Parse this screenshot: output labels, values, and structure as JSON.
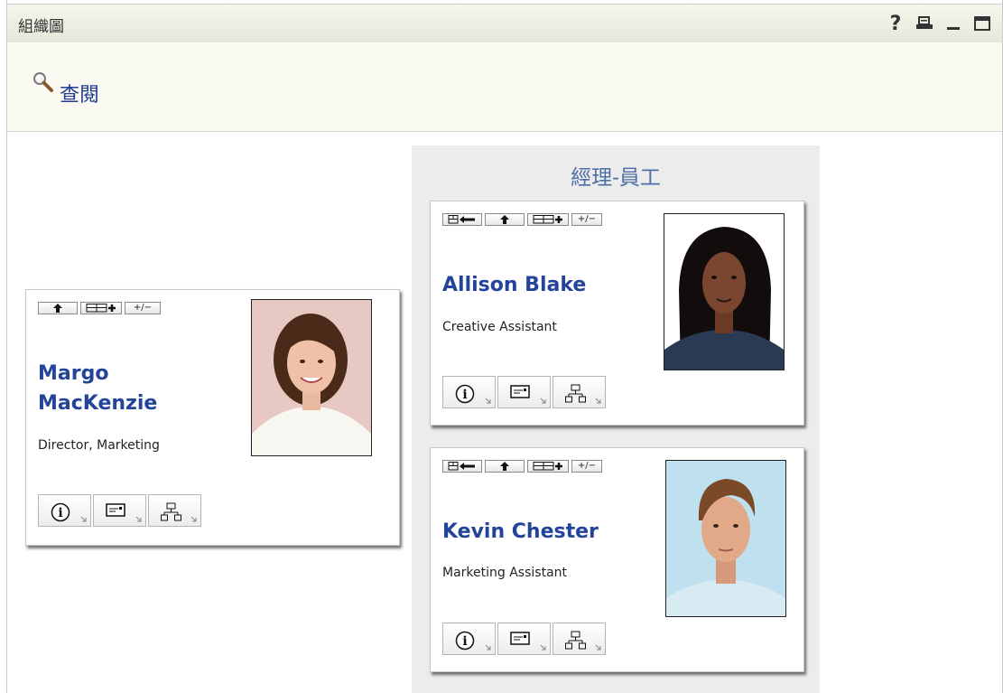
{
  "window": {
    "title": "組織圖",
    "tools": {
      "help": "?",
      "print_icon": "print-icon",
      "minimize_icon": "minimize-icon",
      "maximize_icon": "maximize-icon"
    }
  },
  "toolbar": {
    "lookup_label": "查閱",
    "lookup_icon": "magnifier-icon"
  },
  "relationship": {
    "title": "經理-員工"
  },
  "root_person": {
    "name": "Margo MacKenzie",
    "title": "Director, Marketing",
    "photo_icon": "portrait-photo",
    "controls": [
      "up-arrow-icon",
      "org-add-icon",
      "expand-collapse-icon"
    ],
    "expand_collapse_label": "+/−",
    "actions": [
      "info-icon",
      "email-icon",
      "org-chart-icon"
    ]
  },
  "reports": [
    {
      "name": "Allison Blake",
      "title": "Creative Assistant",
      "photo_icon": "portrait-photo",
      "controls": [
        "reparent-icon",
        "up-arrow-icon",
        "org-add-icon",
        "expand-collapse-icon"
      ],
      "expand_collapse_label": "+/−",
      "actions": [
        "info-icon",
        "email-icon",
        "org-chart-icon"
      ]
    },
    {
      "name": "Kevin Chester",
      "title": "Marketing Assistant",
      "photo_icon": "portrait-photo",
      "controls": [
        "reparent-icon",
        "up-arrow-icon",
        "org-add-icon",
        "expand-collapse-icon"
      ],
      "expand_collapse_label": "+/−",
      "actions": [
        "info-icon",
        "email-icon",
        "org-chart-icon"
      ]
    }
  ],
  "colors": {
    "name_link": "#24449a",
    "panel_bg": "#ececec",
    "title_bar": "#eeeee4",
    "relationship_title": "#4e6fa6"
  }
}
